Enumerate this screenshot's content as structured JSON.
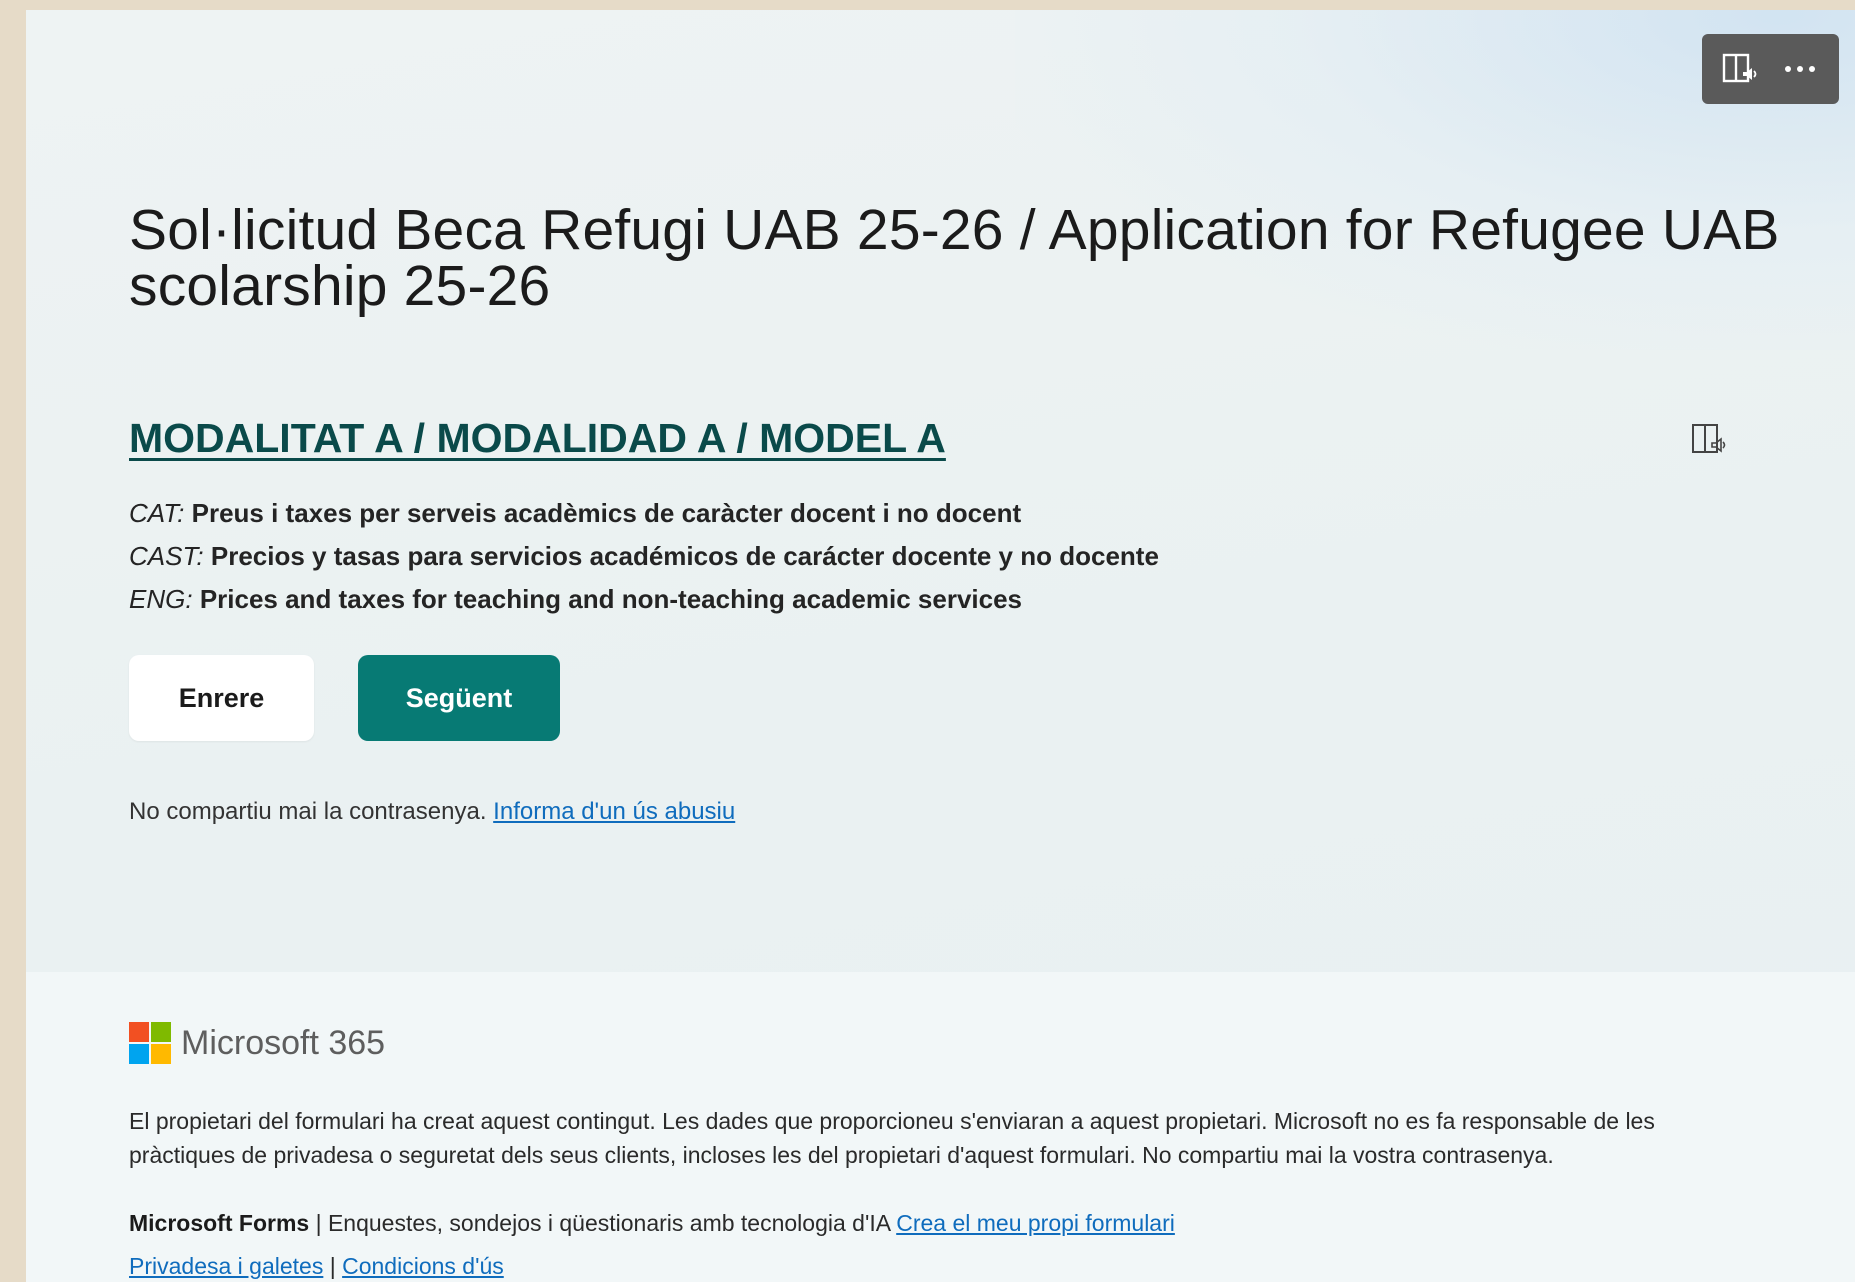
{
  "toolbar": {
    "immersive_reader_icon": "immersive-reader-icon",
    "more_icon": "more-options-icon"
  },
  "form": {
    "title": "Sol·licitud Beca Refugi UAB  25-26 / Application for Refugee UAB scolarship 25-26"
  },
  "section": {
    "title": "MODALITAT A / MODALIDAD A / MODEL A",
    "lines": [
      {
        "lang": "CAT:",
        "text": "Preus i taxes per serveis acadèmics de caràcter docent i no docent"
      },
      {
        "lang": "CAST:",
        "text": "Precios y tasas para servicios académicos de carácter docente y no docente"
      },
      {
        "lang": "ENG:",
        "text": "Prices and taxes for teaching and non-teaching academic services"
      }
    ]
  },
  "nav": {
    "back_label": "Enrere",
    "next_label": "Següent"
  },
  "notice": {
    "text": "No compartiu mai la contrasenya.",
    "report_link": "Informa d'un ús abusiu"
  },
  "footer": {
    "brand": "Microsoft 365",
    "disclaimer": "El propietari del formulari ha creat aquest contingut. Les dades que proporcioneu s'enviaran a aquest propietari. Microsoft no es fa responsable de les pràctiques de privadesa o seguretat dels seus clients, incloses les del propietari d'aquest formulari. No compartiu mai la vostra contrasenya.",
    "forms_brand": "Microsoft Forms",
    "forms_tagline": "| Enquestes, sondejos i qüestionaris amb tecnologia d'IA",
    "create_link": "Crea el meu propi formulari",
    "privacy_link": "Privadesa i galetes",
    "separator": "|",
    "terms_link": "Condicions d'ús"
  },
  "colors": {
    "accent": "#077a74",
    "section_title": "#0a4a4a",
    "link": "#0f6cbd",
    "ms_red": "#f25022",
    "ms_green": "#7fba00",
    "ms_blue": "#00a4ef",
    "ms_yellow": "#ffb900"
  }
}
